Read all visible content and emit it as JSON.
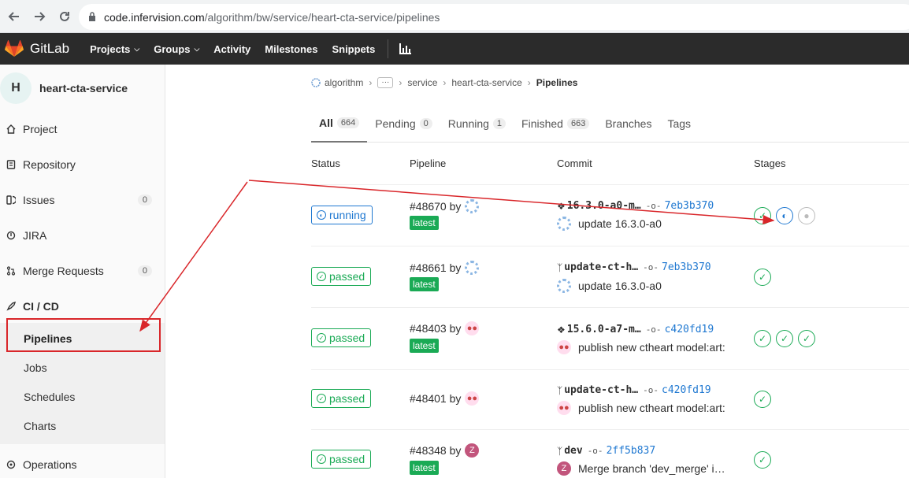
{
  "browser": {
    "url_host": "code.infervision.com",
    "url_path": "/algorithm/bw/service/heart-cta-service/pipelines"
  },
  "topbar": {
    "logo_text": "GitLab",
    "items": [
      {
        "label": "Projects",
        "dropdown": true
      },
      {
        "label": "Groups",
        "dropdown": true
      },
      {
        "label": "Activity",
        "dropdown": false
      },
      {
        "label": "Milestones",
        "dropdown": false
      },
      {
        "label": "Snippets",
        "dropdown": false
      }
    ]
  },
  "sidebar": {
    "avatar_letter": "H",
    "project_name": "heart-cta-service",
    "items": [
      {
        "label": "Project"
      },
      {
        "label": "Repository"
      },
      {
        "label": "Issues",
        "badge": "0"
      },
      {
        "label": "JIRA"
      },
      {
        "label": "Merge Requests",
        "badge": "0"
      },
      {
        "label": "CI / CD"
      },
      {
        "label": "Operations"
      }
    ],
    "sub_items": [
      {
        "label": "Pipelines"
      },
      {
        "label": "Jobs"
      },
      {
        "label": "Schedules"
      },
      {
        "label": "Charts"
      }
    ]
  },
  "breadcrumb": {
    "items": [
      "algorithm",
      "service",
      "heart-cta-service"
    ],
    "current": "Pipelines"
  },
  "tabs": [
    {
      "label": "All",
      "count": "664"
    },
    {
      "label": "Pending",
      "count": "0"
    },
    {
      "label": "Running",
      "count": "1"
    },
    {
      "label": "Finished",
      "count": "663"
    },
    {
      "label": "Branches",
      "count": ""
    },
    {
      "label": "Tags",
      "count": ""
    }
  ],
  "columns": {
    "status": "Status",
    "pipeline": "Pipeline",
    "commit": "Commit",
    "stages": "Stages"
  },
  "pipelines": [
    {
      "status": "running",
      "id": "#48670",
      "by": "by",
      "latest": "latest",
      "ref": "16.3.0-a0-m…",
      "sha": "7eb3b370",
      "message": "update 16.3.0-a0"
    },
    {
      "status": "passed",
      "id": "#48661",
      "by": "by",
      "latest": "latest",
      "ref": "update-ct-h…",
      "sha": "7eb3b370",
      "message": "update 16.3.0-a0"
    },
    {
      "status": "passed",
      "id": "#48403",
      "by": "by",
      "latest": "latest",
      "ref": "15.6.0-a7-m…",
      "sha": "c420fd19",
      "message": "publish new ctheart model:art:"
    },
    {
      "status": "passed",
      "id": "#48401",
      "by": "by",
      "latest": "",
      "ref": "update-ct-h…",
      "sha": "c420fd19",
      "message": "publish new ctheart model:art:"
    },
    {
      "status": "passed",
      "id": "#48348",
      "by": "by",
      "latest": "latest",
      "ref": "dev",
      "sha": "2ff5b837",
      "message": "Merge branch 'dev_merge' i…"
    }
  ],
  "colors": {
    "passed": "#1aaa55",
    "running": "#1f78d1",
    "annotation": "#d9262a"
  }
}
